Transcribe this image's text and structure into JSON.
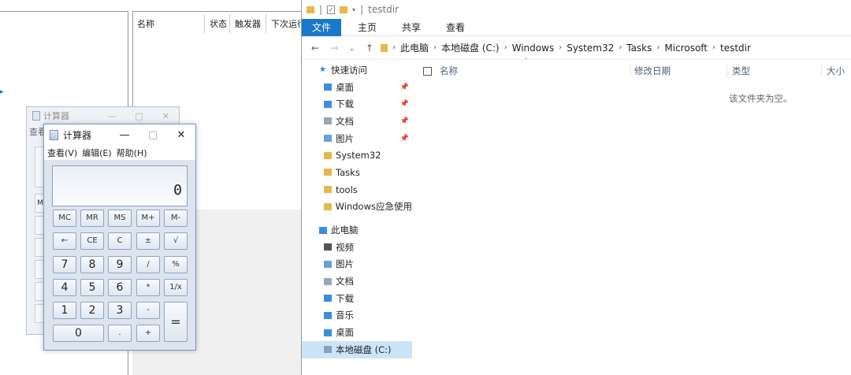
{
  "task_scheduler": {
    "columns": [
      "名称",
      "状态",
      "触发器",
      "下次运行"
    ]
  },
  "calc_back": {
    "title": "计算器",
    "menu_fragment": "查看",
    "stub_labels": [
      "M"
    ]
  },
  "calculator": {
    "title": "计算器",
    "controls": {
      "minimize": "—",
      "maximize": "□",
      "close": "✕"
    },
    "menu": [
      "查看(V)",
      "编辑(E)",
      "帮助(H)"
    ],
    "display": "0",
    "buttons": [
      [
        "MC",
        "MR",
        "MS",
        "M+",
        "M-"
      ],
      [
        "←",
        "CE",
        "C",
        "±",
        "√"
      ],
      [
        "7",
        "8",
        "9",
        "/",
        "%"
      ],
      [
        "4",
        "5",
        "6",
        "*",
        "1/x"
      ],
      [
        "1",
        "2",
        "3",
        "-",
        "="
      ],
      [
        "0",
        ".",
        "+"
      ]
    ]
  },
  "explorer": {
    "window_title": "testdir",
    "ribbon_tabs": [
      "文件",
      "主页",
      "共享",
      "查看"
    ],
    "breadcrumbs": [
      "此电脑",
      "本地磁盘 (C:)",
      "Windows",
      "System32",
      "Tasks",
      "Microsoft",
      "testdir"
    ],
    "columns": [
      "名称",
      "修改日期",
      "类型",
      "大小"
    ],
    "empty_message": "该文件夹为空。",
    "nav": [
      {
        "label": "快速访问",
        "icon": "star-icon",
        "color": "#2a7fd4",
        "pinned": false,
        "level": 0
      },
      {
        "label": "桌面",
        "icon": "desktop-folder-icon",
        "color": "#3b8ede",
        "pinned": true,
        "level": 1
      },
      {
        "label": "下载",
        "icon": "download-folder-icon",
        "color": "#3b8ede",
        "pinned": true,
        "level": 1
      },
      {
        "label": "文档",
        "icon": "documents-folder-icon",
        "color": "#9aa6b8",
        "pinned": true,
        "level": 1
      },
      {
        "label": "图片",
        "icon": "pictures-folder-icon",
        "color": "#6aa0d8",
        "pinned": true,
        "level": 1
      },
      {
        "label": "System32",
        "icon": "folder-icon",
        "color": "#e6b84d",
        "pinned": false,
        "level": 1
      },
      {
        "label": "Tasks",
        "icon": "folder-icon",
        "color": "#e6b84d",
        "pinned": false,
        "level": 1
      },
      {
        "label": "tools",
        "icon": "folder-icon",
        "color": "#e6b84d",
        "pinned": false,
        "level": 1
      },
      {
        "label": "Windows应急使用",
        "icon": "folder-icon",
        "color": "#e6b84d",
        "pinned": false,
        "level": 1
      },
      {
        "label": "",
        "icon": "",
        "color": "",
        "pinned": false,
        "level": -1
      },
      {
        "label": "此电脑",
        "icon": "computer-icon",
        "color": "#3b8ede",
        "pinned": false,
        "level": 0
      },
      {
        "label": "视频",
        "icon": "videos-folder-icon",
        "color": "#555555",
        "pinned": false,
        "level": 1
      },
      {
        "label": "图片",
        "icon": "pictures-folder-icon",
        "color": "#6aa0d8",
        "pinned": false,
        "level": 1
      },
      {
        "label": "文档",
        "icon": "documents-folder-icon",
        "color": "#9aa6b8",
        "pinned": false,
        "level": 1
      },
      {
        "label": "下载",
        "icon": "download-folder-icon",
        "color": "#3b8ede",
        "pinned": false,
        "level": 1
      },
      {
        "label": "音乐",
        "icon": "music-folder-icon",
        "color": "#3b8ede",
        "pinned": false,
        "level": 1
      },
      {
        "label": "桌面",
        "icon": "desktop-folder-icon",
        "color": "#3b8ede",
        "pinned": false,
        "level": 1
      },
      {
        "label": "本地磁盘 (C:)",
        "icon": "drive-icon",
        "color": "#8aa0bb",
        "pinned": false,
        "level": 1,
        "selected": true
      }
    ]
  }
}
